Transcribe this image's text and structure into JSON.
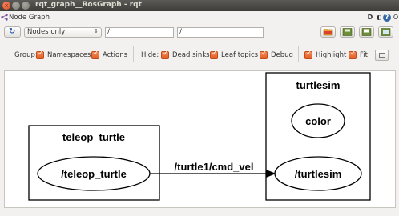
{
  "window": {
    "title": "rqt_graph__RosGraph - rqt",
    "close_glyph": "×",
    "min_glyph": "–",
    "max_glyph": "□"
  },
  "plugin": {
    "title": "Node Graph",
    "help_glyph": "D",
    "settings_glyph": "◐",
    "help2_glyph": "?",
    "close_glyph": "O"
  },
  "toolbar": {
    "refresh_icon": "refresh-icon",
    "mode_value": "Nodes only",
    "ns_filter_value": "/",
    "topic_filter_value": "/"
  },
  "options": {
    "group_label": "Group:",
    "namespaces_label": "Namespaces",
    "actions_label": "Actions",
    "hide_label": "Hide:",
    "dead_sinks_label": "Dead sinks",
    "leaf_topics_label": "Leaf topics",
    "debug_label": "Debug",
    "highlight_label": "Highlight",
    "fit_label": "Fit"
  },
  "graph": {
    "cluster_left_label": "teleop_turtle",
    "cluster_right_label": "turtlesim",
    "node_teleop": "/teleop_turtle",
    "node_color": "color",
    "node_turtlesim": "/turtlesim",
    "edge_label": "/turtle1/cmd_vel"
  }
}
